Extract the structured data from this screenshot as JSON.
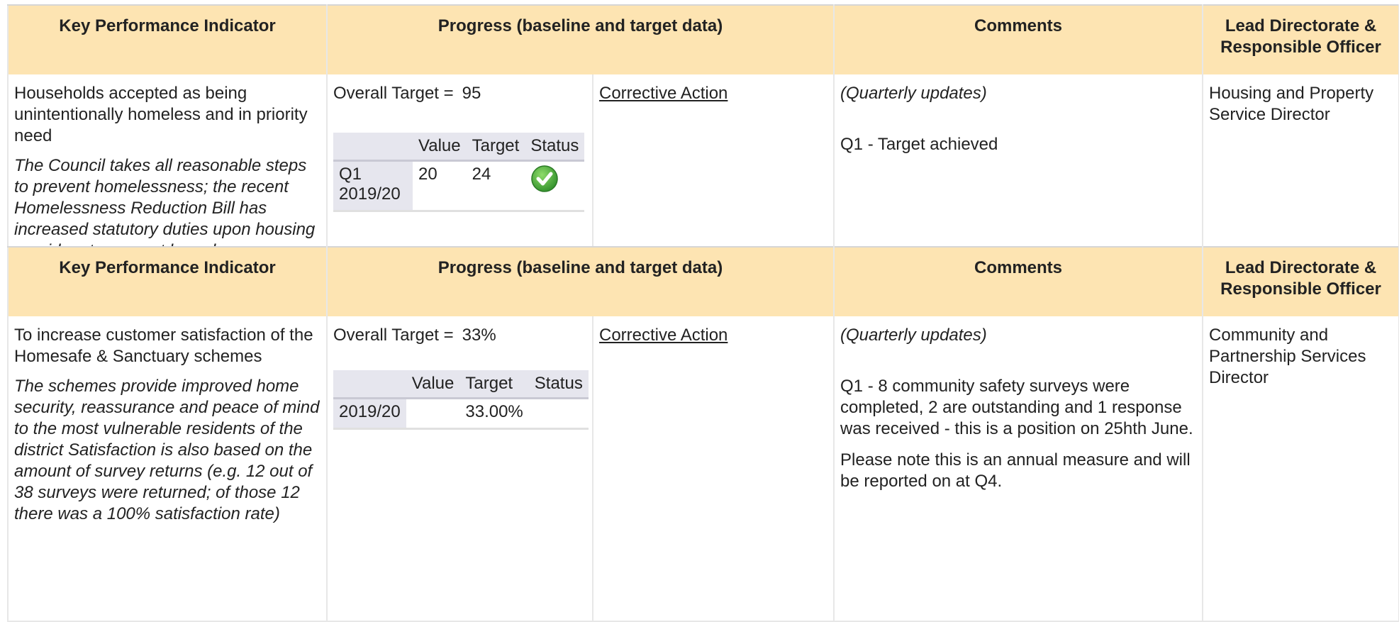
{
  "headers": {
    "kpi": "Key Performance Indicator",
    "progress": "Progress (baseline and target data)",
    "comments": "Comments",
    "lead": "Lead Directorate & Responsible Officer"
  },
  "rows": [
    {
      "title": "Households accepted as being unintentionally homeless and in priority need",
      "description": "The Council takes all reasonable steps to prevent homelessness; the recent Homelessness Reduction Bill has increased statutory duties upon housing providers to prevent homelessness",
      "overall_target_label": "Overall Target =",
      "overall_target_value": "95",
      "corrective_action": "Corrective Action",
      "mini_table": {
        "columns": [
          "Value",
          "Target",
          "Status"
        ],
        "rows": [
          {
            "period": "Q1 2019/20",
            "value": "20",
            "target": "24",
            "status_icon": "check-circle-icon",
            "status_color": "#3fa535"
          }
        ]
      },
      "comments_header": "(Quarterly updates)",
      "comments": [
        "Q1 - Target achieved"
      ],
      "lead": "Housing and Property Service Director"
    },
    {
      "title": "To increase customer satisfaction of the Homesafe & Sanctuary schemes",
      "description": "The schemes provide improved home security, reassurance and peace of mind to the most vulnerable residents of the district Satisfaction is also based on the amount of survey returns (e.g. 12 out of 38 surveys were returned; of those 12 there was a 100% satisfaction rate)",
      "overall_target_label": "Overall Target =",
      "overall_target_value": "33%",
      "corrective_action": "Corrective Action",
      "mini_table": {
        "columns": [
          "Value",
          "Target",
          "Status"
        ],
        "rows": [
          {
            "period": "2019/20",
            "value": "",
            "target": "33.00%",
            "status_icon": "",
            "status_color": ""
          }
        ]
      },
      "comments_header": "(Quarterly updates)",
      "comments": [
        "Q1 - 8 community safety surveys were completed, 2 are outstanding and 1 response was received - this is a position on 25hth June.",
        "Please note this is an annual measure and will be reported on at Q4."
      ],
      "lead": "Community and Partnership Services Director"
    }
  ]
}
